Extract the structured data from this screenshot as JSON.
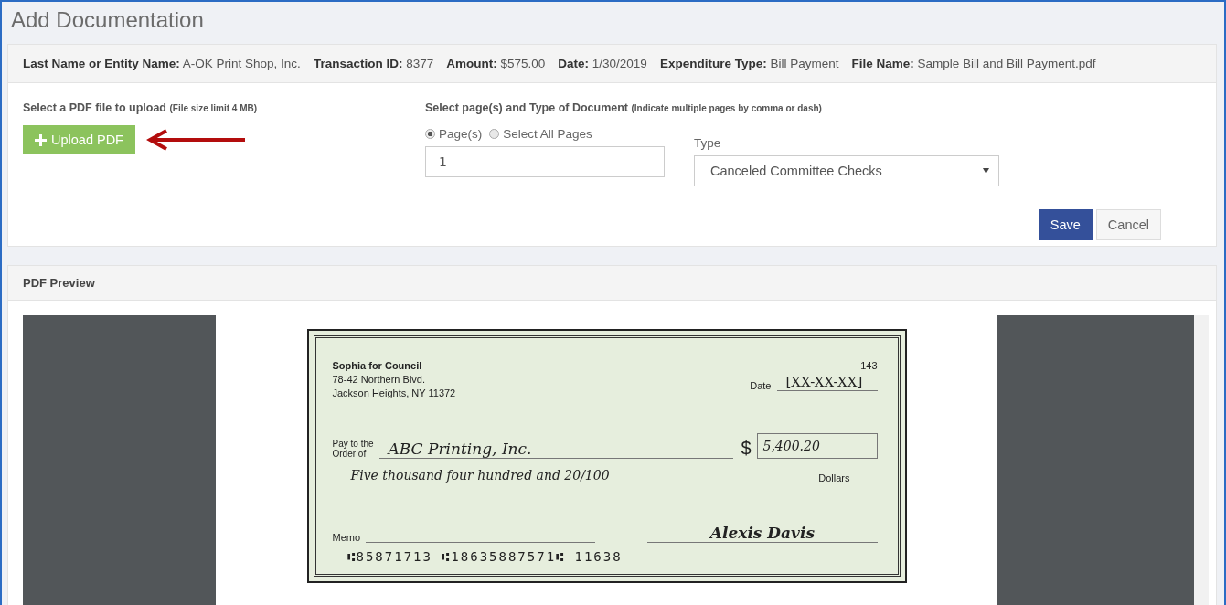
{
  "title": "Add Documentation",
  "info": [
    {
      "label": "Last Name or Entity Name:",
      "value": "A-OK Print Shop, Inc."
    },
    {
      "label": "Transaction ID:",
      "value": "8377"
    },
    {
      "label": "Amount:",
      "value": "$575.00"
    },
    {
      "label": "Date:",
      "value": "1/30/2019"
    },
    {
      "label": "Expenditure Type:",
      "value": "Bill Payment"
    },
    {
      "label": "File Name:",
      "value": "Sample Bill and Bill Payment.pdf"
    }
  ],
  "upload": {
    "heading": "Select a PDF file to upload",
    "note": "(File size limit 4 MB)",
    "button": "Upload PDF"
  },
  "pages": {
    "heading": "Select page(s) and Type of Document",
    "note": "(Indicate multiple pages by comma or dash)",
    "options": [
      {
        "label": "Page(s)",
        "selected": true
      },
      {
        "label": "Select All Pages",
        "selected": false
      }
    ],
    "value": "1"
  },
  "type": {
    "label": "Type",
    "value": "Canceled Committee Checks"
  },
  "buttons": [
    {
      "label": "Save",
      "kind": "primary"
    },
    {
      "label": "Cancel",
      "kind": "default"
    }
  ],
  "preview": {
    "heading": "PDF Preview",
    "check": {
      "payer": "Sophia for Council",
      "address_1": "78-42 Northern Blvd.",
      "address_2": "Jackson Heights, NY 11372",
      "number": "143",
      "date_label": "Date",
      "date": "[XX-XX-XX]",
      "pay_label_1": "Pay to the",
      "pay_label_2": "Order of",
      "payee": "ABC Printing, Inc.",
      "dollar_sign": "$",
      "amount": "5,400.20",
      "amount_words": "Five thousand four hundred and 20/100",
      "dollars_label": "Dollars",
      "memo_label": "Memo",
      "signature": "Alexis Davis",
      "micr": "⑆85871713 ⑆18635887571⑆ 11638"
    }
  }
}
